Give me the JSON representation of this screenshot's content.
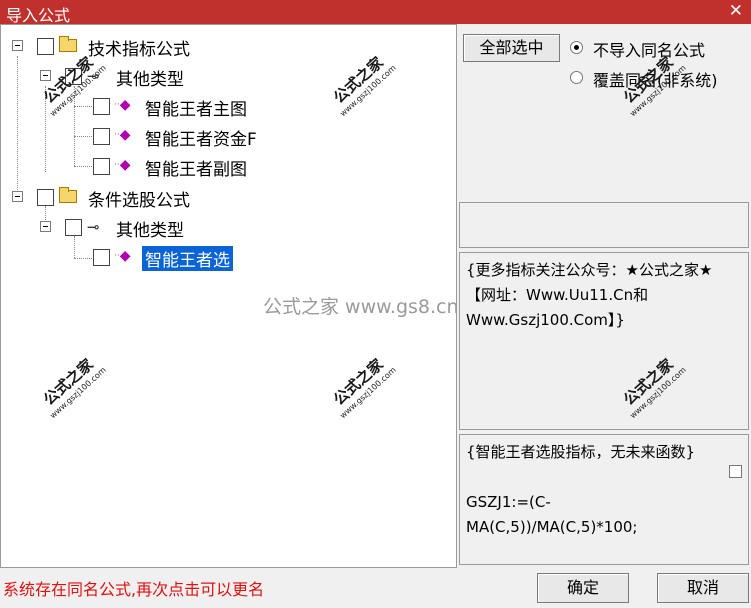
{
  "window": {
    "title": "导入公式",
    "close_glyph": "✕"
  },
  "tree": {
    "group1": {
      "label": "技术指标公式",
      "category": "其他类型",
      "items": [
        "智能王者主图",
        "智能王者资金F",
        "智能王者副图"
      ]
    },
    "group2": {
      "label": "条件选股公式",
      "category": "其他类型",
      "items": [
        "智能王者选"
      ]
    }
  },
  "right_panel": {
    "select_all_button": "全部选中",
    "radio_skip_label": "不导入同名公式",
    "radio_overwrite_label": "覆盖同名(非系统)",
    "radio_selected": "skip",
    "notice_text": "{更多指标关注公众号：★公式之家★ 【网址：Www.Uu11.Cn和Www.Gszj100.Com】}",
    "formula_desc": "{智能王者选股指标，无未来函数}",
    "formula_code": "GSZJ1:=(C-MA(C,5))/MA(C,5)*100;"
  },
  "footer": {
    "status_text": "系统存在同名公式,再次点击可以更名",
    "ok_button": "确定",
    "cancel_button": "取消",
    "status_color": "#e01010"
  },
  "watermark": {
    "center_text": "公式之家 www.gs8.cn",
    "stamp_title": "公式之家",
    "stamp_url": "www.gszj100.com"
  },
  "colors": {
    "title_bar": "#c0302c",
    "selection": "#0a64d6",
    "gem": "#b000b0"
  }
}
